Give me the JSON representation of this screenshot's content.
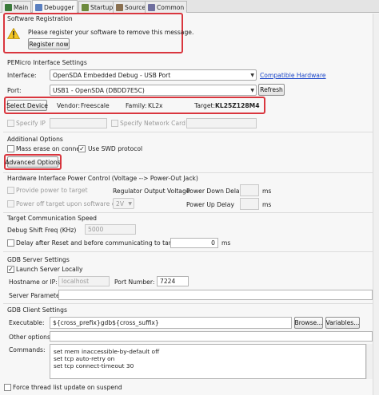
{
  "tabs": [
    {
      "label": "Main",
      "icon": "main-icon",
      "color": "#3a7a3a"
    },
    {
      "label": "Debugger",
      "icon": "debugger-icon",
      "color": "#5a7fc0"
    },
    {
      "label": "Startup",
      "icon": "startup-icon",
      "color": "#6c8a3c"
    },
    {
      "label": "Source",
      "icon": "source-icon",
      "color": "#8a7050"
    },
    {
      "label": "Common",
      "icon": "common-icon",
      "color": "#6f6f9f"
    }
  ],
  "registration": {
    "title": "Software Registration",
    "message": "Please register your software to remove this message.",
    "button": "Register now"
  },
  "pemicro": {
    "title": "PEMicro Interface Settings",
    "interface_label": "Interface:",
    "interface_value": "OpenSDA Embedded Debug - USB Port",
    "compatible_link": "Compatible Hardware",
    "port_label": "Port:",
    "port_value": "USB1 - OpenSDA (DBDD7E5C)",
    "refresh": "Refresh",
    "select_device": "Select Device",
    "vendor_label": "Vendor:",
    "vendor_value": "Freescale",
    "family_label": "Family:",
    "family_value": "KL2x",
    "target_label": "Target:",
    "target_value": "KL25Z128M4",
    "specify_ip": "Specify IP",
    "specify_nic": "Specify Network Card IP"
  },
  "additional": {
    "title": "Additional Options",
    "mass_erase": "Mass erase on connect",
    "use_swd": "Use SWD protocol",
    "advanced": "Advanced Options"
  },
  "power": {
    "title": "Hardware Interface Power Control (Voltage --> Power-Out Jack)",
    "provide": "Provide power to target",
    "regulator": "Regulator Output Voltage",
    "down_delay": "Power Down Delay",
    "ms": "ms",
    "power_off": "Power off target upon software exit",
    "voltage": "2V",
    "up_delay": "Power Up Delay"
  },
  "comm": {
    "title": "Target Communication Speed",
    "shift_label": "Debug Shift Freq (KHz)",
    "shift_value": "5000",
    "delay_label": "Delay after Reset and before communicating to target for",
    "delay_value": "0",
    "ms": "ms"
  },
  "gdb_server": {
    "title": "GDB Server Settings",
    "launch": "Launch Server Locally",
    "host_label": "Hostname or IP:",
    "host_value": "localhost",
    "port_label": "Port Number:",
    "port_value": "7224",
    "params_label": "Server Parameters:"
  },
  "gdb_client": {
    "title": "GDB Client Settings",
    "exec_label": "Executable:",
    "exec_value": "${cross_prefix}gdb${cross_suffix}",
    "browse": "Browse...",
    "variables": "Variables...",
    "other_label": "Other options:",
    "commands_label": "Commands:",
    "commands_value": "set mem inaccessible-by-default off\nset tcp auto-retry on\nset tcp connect-timeout 30"
  },
  "force_thread": "Force thread list update on suspend",
  "highlight_color": "#d9363e"
}
